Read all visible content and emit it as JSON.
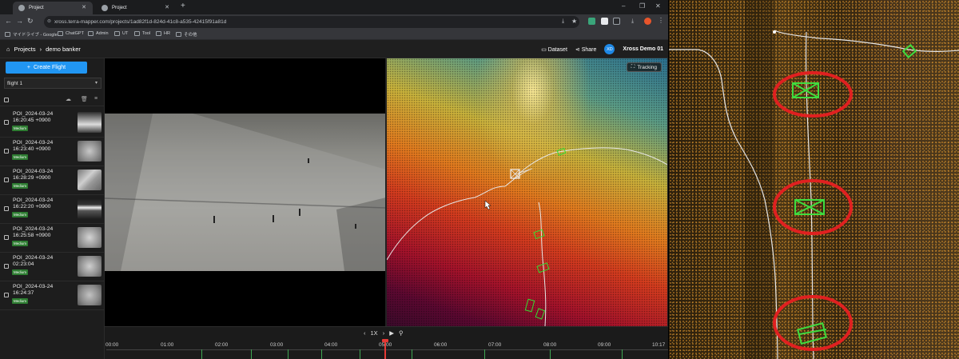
{
  "browser": {
    "tabs": [
      {
        "label": "Project"
      },
      {
        "label": "Project"
      }
    ],
    "new_tab": "+",
    "window_controls": {
      "minimize": "–",
      "maximize": "❐",
      "close": "✕"
    },
    "url": "xross.terra-mapper.com/projects/1ad82f1d-824d-41c8-a535-42415f91a81d",
    "bookmarks": [
      "マイドライブ - Google...",
      "ChatGPT",
      "Admin",
      "UT",
      "Tool",
      "HR",
      "その他"
    ]
  },
  "header": {
    "projects": "Projects",
    "project_name": "demo banker",
    "dataset": "Dataset",
    "share": "Share",
    "avatar": "XD",
    "user": "Xross Demo 01"
  },
  "sidebar": {
    "create_label": "Create Flight",
    "flight_select": "flight 1",
    "items": [
      {
        "line1": "POI_2024-03-24",
        "line2": "16:20:45 +0900",
        "badge": "Medium"
      },
      {
        "line1": "POI_2024-03-24",
        "line2": "16:23:40 +0900",
        "badge": "Medium"
      },
      {
        "line1": "POI_2024-03-24",
        "line2": "16:28:29 +0900",
        "badge": "Medium"
      },
      {
        "line1": "POI_2024-03-24",
        "line2": "16:22:20 +0900",
        "badge": "Medium"
      },
      {
        "line1": "POI_2024-03-24",
        "line2": "16:25:58 +0900",
        "badge": "Medium"
      },
      {
        "line1": "POI_2024-03-24",
        "line2": "02:23:04",
        "badge": "Medium"
      },
      {
        "line1": "POI_2024-03-24",
        "line2": "16:24:37",
        "badge": "Medium"
      }
    ]
  },
  "pointcloud": {
    "tracking_label": "Tracking"
  },
  "timeline": {
    "speed": "1X",
    "ticks": [
      "00:00",
      "01:00",
      "02:00",
      "03:00",
      "04:00",
      "05:00",
      "06:00",
      "07:00",
      "08:00",
      "09:00",
      "10:17"
    ]
  },
  "colors": {
    "accent": "#2196f3",
    "badge": "#2e7d32",
    "playhead": "#e53935",
    "marker": "#3fa652",
    "highlight": "#e02020",
    "poi_box": "#33dd33"
  },
  "icons": [
    "home-icon",
    "chevron-right-icon",
    "folder-icon",
    "share-icon",
    "plus-icon",
    "chevron-down-icon",
    "cloud-download-icon",
    "trash-icon",
    "sort-icon",
    "tracking-icon",
    "play-icon",
    "location-pin-icon"
  ]
}
